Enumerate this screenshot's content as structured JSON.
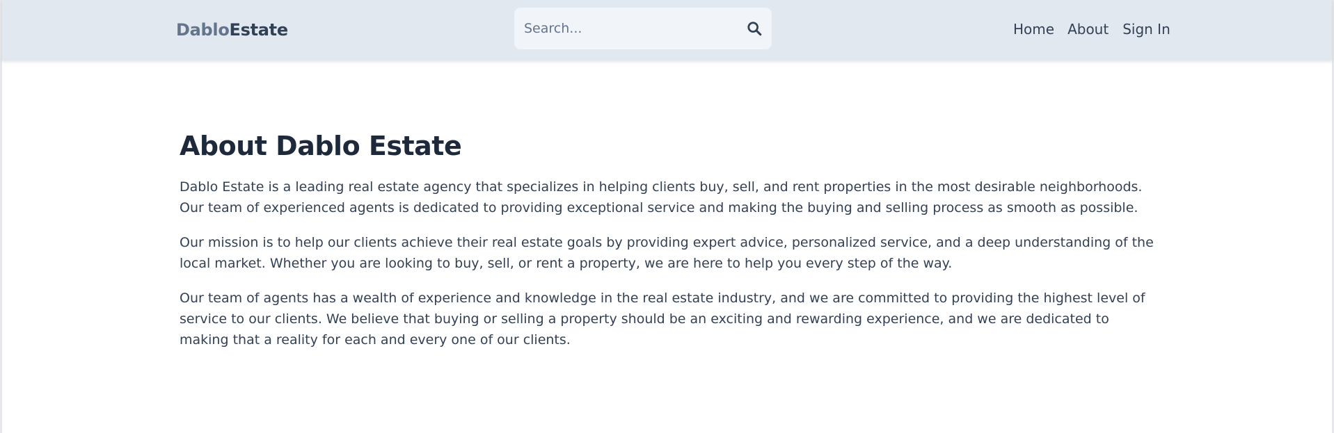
{
  "header": {
    "logo_part1": "Dablo",
    "logo_part2": "Estate",
    "search": {
      "placeholder": "Search...",
      "value": ""
    },
    "nav": {
      "home": "Home",
      "about": "About",
      "sign_in": "Sign In"
    },
    "icons": {
      "search": "search-icon"
    }
  },
  "main": {
    "title": "About Dablo Estate",
    "paragraphs": [
      "Dablo Estate is a leading real estate agency that specializes in helping clients buy, sell, and rent properties in the most desirable neighborhoods. Our team of experienced agents is dedicated to providing exceptional service and making the buying and selling process as smooth as possible.",
      "Our mission is to help our clients achieve their real estate goals by providing expert advice, personalized service, and a deep understanding of the local market. Whether you are looking to buy, sell, or rent a property, we are here to help you every step of the way.",
      "Our team of agents has a wealth of experience and knowledge in the real estate industry, and we are committed to providing the highest level of service to our clients. We believe that buying or selling a property should be an exciting and rewarding experience, and we are dedicated to making that a reality for each and every one of our clients."
    ]
  },
  "colors": {
    "header_bg": "#e2e8f0",
    "search_bg": "#f1f5f9",
    "logo_light": "#64748b",
    "logo_dark": "#334155",
    "title": "#1e293b",
    "text": "#334155"
  }
}
